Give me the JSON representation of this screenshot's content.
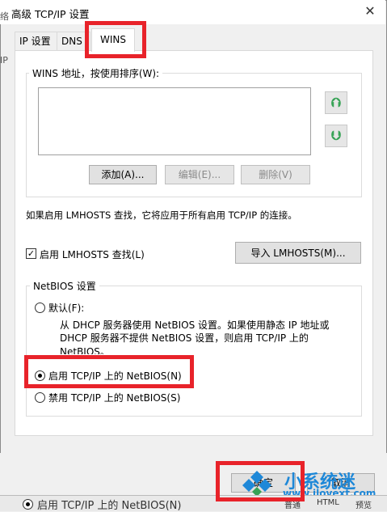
{
  "window": {
    "title": "高级 TCP/IP 设置",
    "close_glyph": "✕"
  },
  "tabs": [
    {
      "label": "IP 设置"
    },
    {
      "label": "DNS"
    },
    {
      "label": "WINS"
    }
  ],
  "wins": {
    "group_title": "WINS 地址，按使用排序(W):",
    "up_glyph": "⮉",
    "down_glyph": "⮋",
    "buttons": {
      "add": "添加(A)...",
      "edit": "编辑(E)...",
      "remove": "删除(V)"
    }
  },
  "lmhosts": {
    "info": "如果启用 LMHOSTS 查找，它将应用于所有启用 TCP/IP 的连接。",
    "enable_label": "启用 LMHOSTS 查找(L)",
    "enable_checked": true,
    "check_glyph": "✓",
    "import_label": "导入 LMHOSTS(M)..."
  },
  "netbios": {
    "group_title": "NetBIOS 设置",
    "default_label": "默认(F):",
    "default_desc": [
      "从 DHCP 服务器使用 NetBIOS 设置。如果使用静态 IP 地址或",
      "DHCP 服务器不提供 NetBIOS 设置，则启用 TCP/IP 上的",
      "NetBIOS。"
    ],
    "enable_label": "启用 TCP/IP 上的 NetBIOS(N)",
    "disable_label": "禁用 TCP/IP 上的 NetBIOS(S)",
    "selected": "enable"
  },
  "dialog_buttons": {
    "ok": "确定",
    "cancel": "取消"
  },
  "background": {
    "left_edge_chars": [
      "络",
      "IP"
    ],
    "under_text": "启用 TCP/IP 上的 NetBIOS(N)",
    "status_tabs": [
      "普通",
      "HTML",
      "预览"
    ]
  },
  "watermark": {
    "name": "小系统迷",
    "url": "www.ilovext.com"
  },
  "colors": {
    "highlight": "#e8232a",
    "arrow_green": "#37a356",
    "watermark_blue": "#1e88d8"
  }
}
